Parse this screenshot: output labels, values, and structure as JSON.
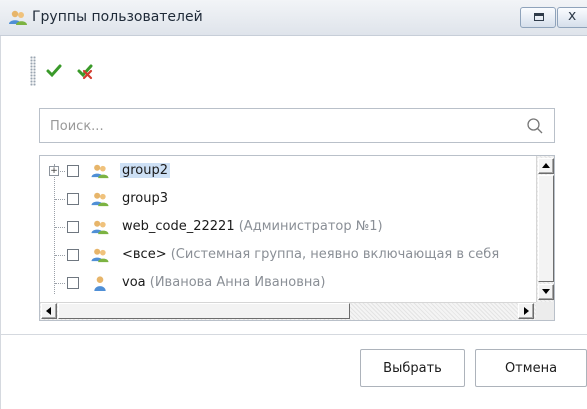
{
  "window": {
    "title": "Группы пользователей"
  },
  "search": {
    "placeholder": "Поиск..."
  },
  "tree": {
    "items": [
      {
        "label": "group2",
        "description": "",
        "icon": "user-group-icon",
        "selected": true,
        "expandable": true
      },
      {
        "label": "group3",
        "description": "",
        "icon": "user-group-icon",
        "selected": false,
        "expandable": false
      },
      {
        "label": "web_code_22221",
        "description": "(Администратор №1)",
        "icon": "user-group-icon",
        "selected": false,
        "expandable": false
      },
      {
        "label": "<все>",
        "description": "(Системная группа, неявно включающая в себя",
        "icon": "user-group-icon",
        "selected": false,
        "expandable": false
      },
      {
        "label": "voa",
        "description": "(Иванова Анна Ивановна)",
        "icon": "user-icon",
        "selected": false,
        "expandable": false
      }
    ]
  },
  "buttons": {
    "select": "Выбрать",
    "cancel": "Отмена"
  },
  "colors": {
    "selection": "#cde0f5",
    "description_text": "#8a8f96",
    "ok_icon": "#3a9a2a",
    "cancel_icon": "#d23b2e"
  }
}
